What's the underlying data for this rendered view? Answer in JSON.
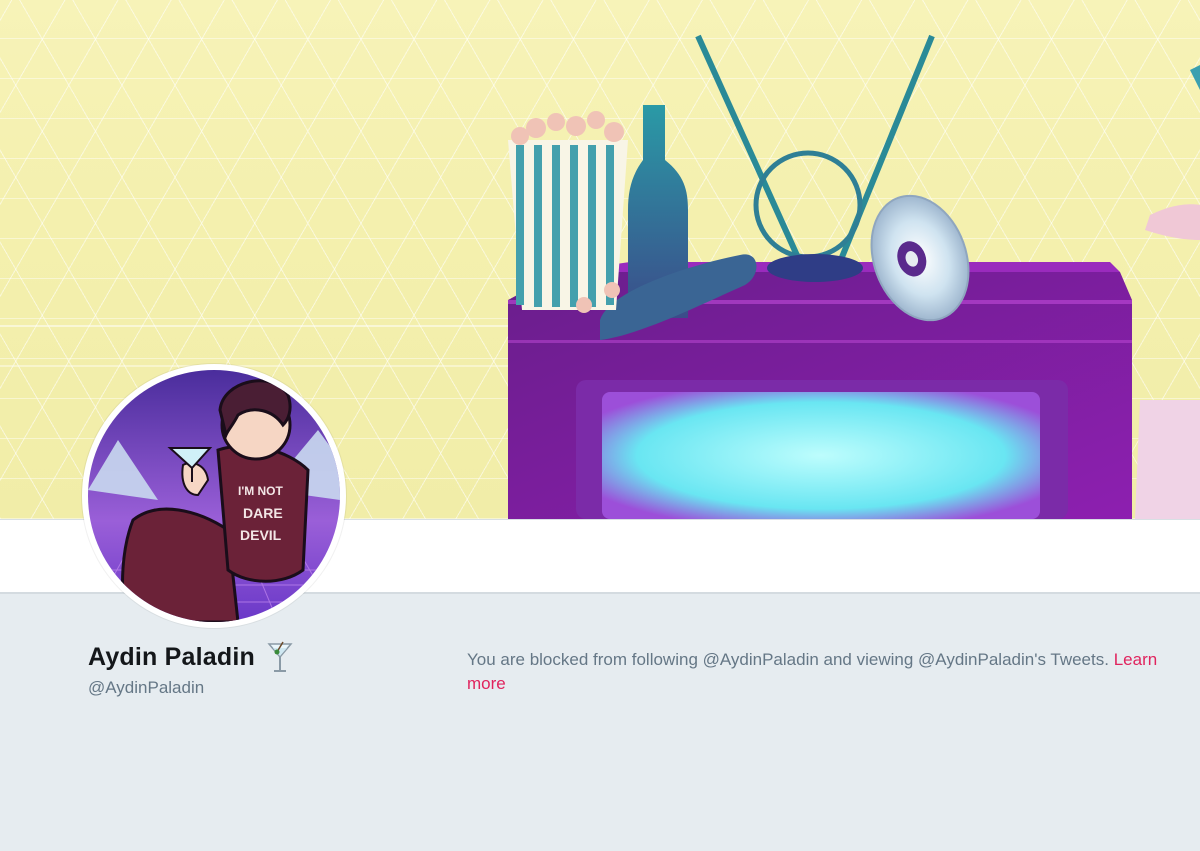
{
  "profile": {
    "display_name": "Aydin Paladin",
    "name_emoji": "cocktail-glass-icon",
    "handle": "@AydinPaladin",
    "avatar_shirt_text": [
      "I'M NOT",
      "DARE",
      "DEVIL"
    ]
  },
  "blocked_notice": {
    "message": "You are blocked from following @AydinPaladin and viewing @AydinPaladin's Tweets.",
    "link_label": "Learn more"
  },
  "colors": {
    "banner_bg": "#f4f0ae",
    "page_bg": "#e6ecf0",
    "link": "#e0245e",
    "muted_text": "#657786",
    "name_text": "#14171a"
  }
}
